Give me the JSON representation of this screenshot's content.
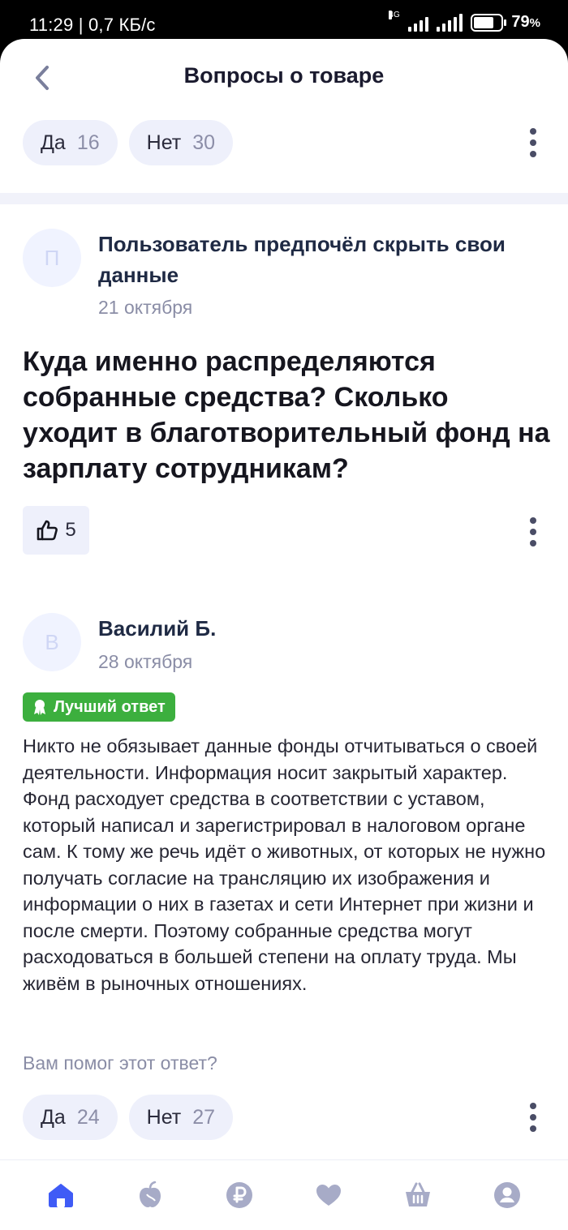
{
  "status_bar": {
    "time_speed": "11:29 | 0,7 КБ/с",
    "network": "4G",
    "battery_percent": "79",
    "battery_level": 0.79
  },
  "header": {
    "title": "Вопросы о товаре"
  },
  "top_votes": {
    "yes_label": "Да",
    "yes_count": "16",
    "no_label": "Нет",
    "no_count": "30"
  },
  "question": {
    "avatar_letter": "П",
    "author": "Пользователь предпочёл скрыть свои данные",
    "date": "21 октября",
    "text": "Куда именно распределяются собранные средства? Сколько уходит в благотворительный фонд на зарплату сотрудникам?",
    "likes": "5"
  },
  "answer": {
    "avatar_letter": "В",
    "author": "Василий Б.",
    "date": "28 октября",
    "badge": "Лучший ответ",
    "text": "Никто не обязывает данные фонды отчитываться о своей деятельности. Информация носит закрытый характер. Фонд расходует средства в соответствии с уставом, который написал и зарегистрировал в налоговом органе сам. К тому же речь идёт о животных, от которых не нужно получать согласие на трансляцию их изображения и информации о них в газетах и сети Интернет при жизни и после смерти. Поэтому собранные средства могут расходоваться в большей степени на оплату труда. Мы живём в рыночных отношениях.",
    "helpful_prompt": "Вам помог этот ответ?",
    "yes_label": "Да",
    "yes_count": "24",
    "no_label": "Нет",
    "no_count": "27"
  },
  "bottom_nav": {
    "items": [
      "home-icon",
      "apple-icon",
      "ruble-icon",
      "heart-icon",
      "basket-icon",
      "profile-icon"
    ],
    "active_color": "#3f5bf6",
    "inactive_color": "#a7abc7"
  }
}
